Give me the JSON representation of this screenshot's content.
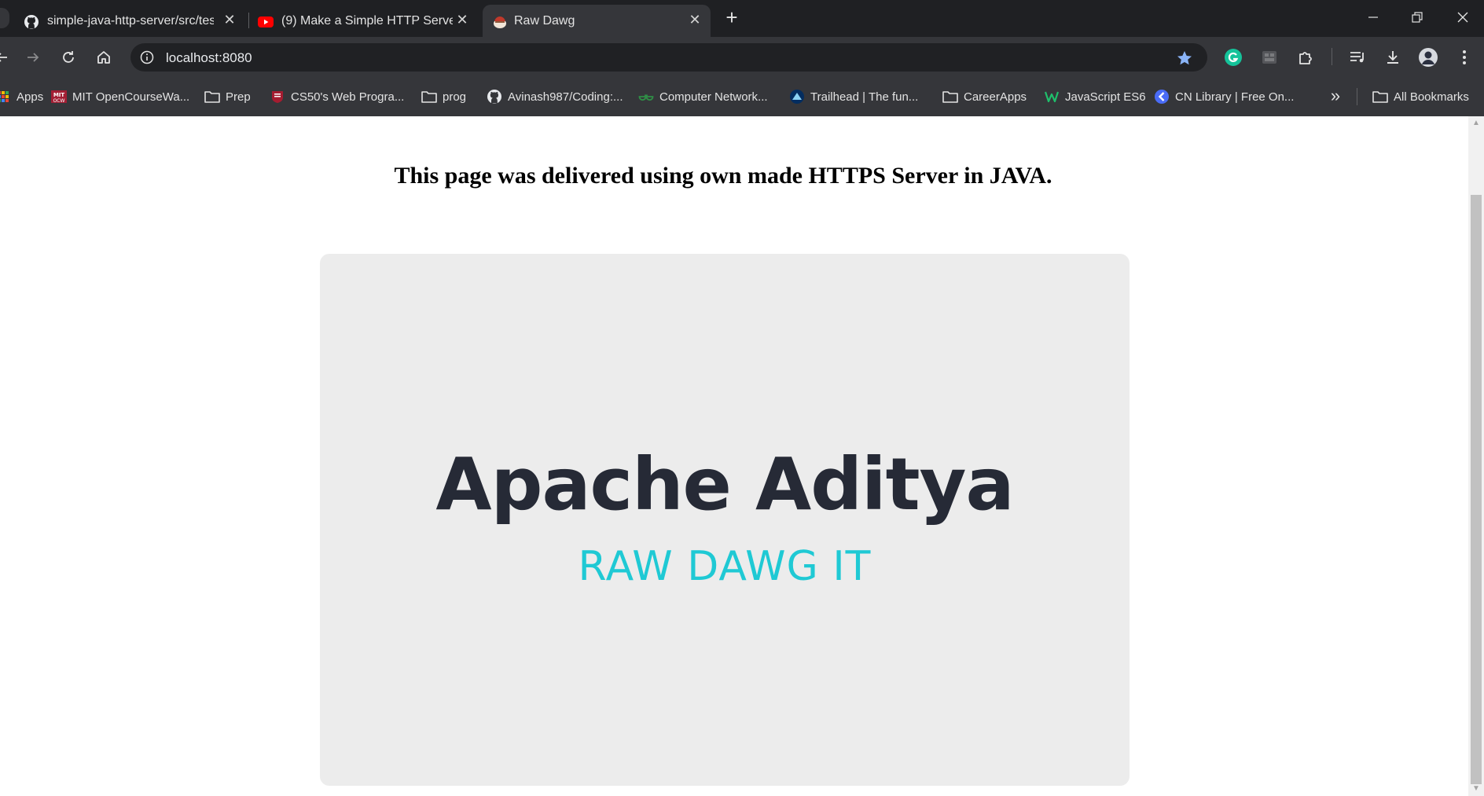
{
  "browser": {
    "tabs": [
      {
        "title": "simple-java-http-server/src/test",
        "favicon": "github-icon",
        "active": false
      },
      {
        "title": "(9) Make a Simple HTTP Server",
        "favicon": "youtube-icon",
        "active": false
      },
      {
        "title": "Raw Dawg",
        "favicon": "raw-dawg-favicon",
        "active": true
      }
    ],
    "new_tab_label": "+",
    "address": "localhost:8080",
    "bookmarks": [
      {
        "label": "Apps",
        "icon": "apps-grid-icon"
      },
      {
        "label": "MIT OpenCourseWa...",
        "icon": "mit-ocw-icon"
      },
      {
        "label": "Prep",
        "icon": "folder-icon"
      },
      {
        "label": "CS50's Web Progra...",
        "icon": "harvard-icon"
      },
      {
        "label": "prog",
        "icon": "folder-icon"
      },
      {
        "label": "Avinash987/Coding:...",
        "icon": "github-icon"
      },
      {
        "label": "Computer Network...",
        "icon": "geeksforgeeks-icon"
      },
      {
        "label": "Trailhead | The fun...",
        "icon": "trailhead-icon"
      },
      {
        "label": "CareerApps",
        "icon": "folder-icon"
      },
      {
        "label": "JavaScript ES6",
        "icon": "w-icon"
      },
      {
        "label": "CN Library | Free On...",
        "icon": "cn-icon"
      }
    ],
    "all_bookmarks_label": "All Bookmarks",
    "colors": {
      "tabstrip": "#1f2023",
      "toolbar": "#35363a",
      "omnibox": "#202124",
      "star": "#8ab4f8"
    }
  },
  "page": {
    "heading": "This page was delivered using own made HTTPS Server in JAVA.",
    "hero_title": "Apache Aditya",
    "hero_subtitle": "RAW DAWG IT",
    "colors": {
      "hero_title": "#262a36",
      "hero_subtitle": "#1fc9d4",
      "card": "#ececec"
    }
  }
}
